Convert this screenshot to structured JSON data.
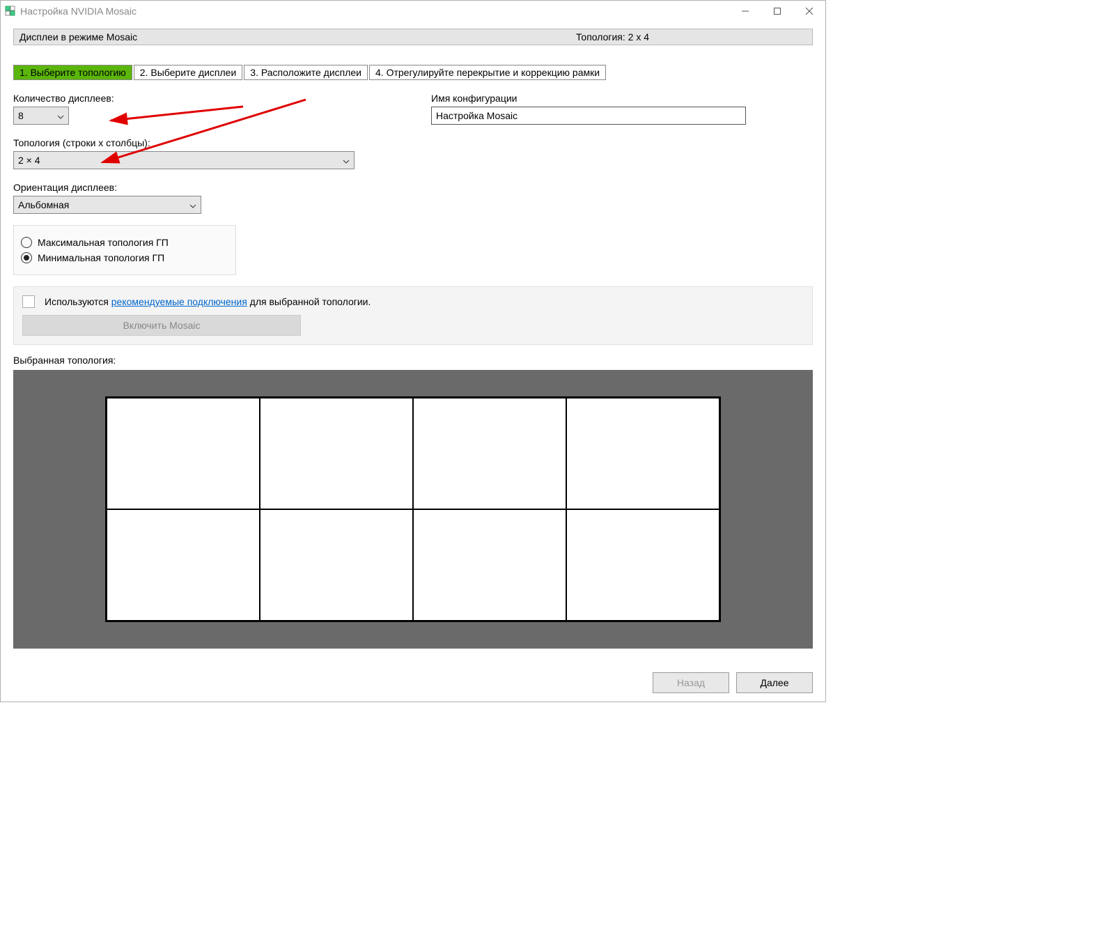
{
  "window": {
    "title": "Настройка NVIDIA Mosaic"
  },
  "header": {
    "left": "Дисплеи в режиме Mosaic",
    "right": "Топология: 2 x 4"
  },
  "tabs": [
    {
      "label": "1. Выберите топологию",
      "active": true
    },
    {
      "label": "2. Выберите дисплеи",
      "active": false
    },
    {
      "label": "3. Расположите дисплеи",
      "active": false
    },
    {
      "label": "4. Отрегулируйте перекрытие и коррекцию рамки",
      "active": false
    }
  ],
  "form": {
    "displays_label": "Количество дисплеев:",
    "displays_value": "8",
    "topology_label": "Топология (строки х столбцы):",
    "topology_value": "2 × 4",
    "orientation_label": "Ориентация дисплеев:",
    "orientation_value": "Альбомная",
    "config_name_label": "Имя конфигурации",
    "config_name_value": "Настройка Mosaic",
    "radio_max": "Максимальная топология ГП",
    "radio_min": "Минимальная топология ГП",
    "info_prefix": "Используются ",
    "info_link": "рекомендуемые подключения",
    "info_suffix": " для выбранной топологии.",
    "enable_btn": "Включить Mosaic",
    "preview_label": "Выбранная топология:"
  },
  "footer": {
    "back": "Назад",
    "next": "Далее"
  },
  "topology_grid": {
    "rows": 2,
    "cols": 4
  }
}
